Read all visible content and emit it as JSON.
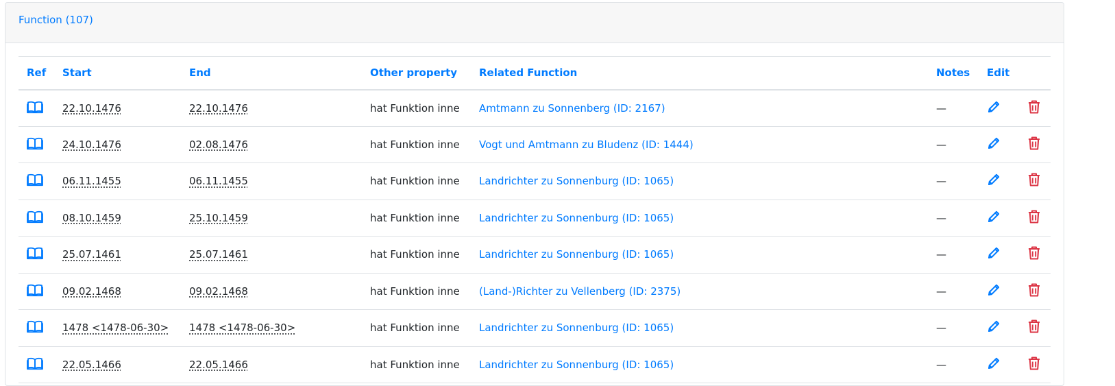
{
  "panel": {
    "title": "Function (107)"
  },
  "table": {
    "headers": {
      "ref": "Ref",
      "start": "Start",
      "end": "End",
      "other_property": "Other property",
      "related_function": "Related Function",
      "notes": "Notes",
      "edit": "Edit"
    },
    "rows": [
      {
        "start": "22.10.1476",
        "end": "22.10.1476",
        "property": "hat Funktion inne",
        "related": "Amtmann zu Sonnenberg (ID: 2167)",
        "notes": "—"
      },
      {
        "start": "24.10.1476",
        "end": "02.08.1476",
        "property": "hat Funktion inne",
        "related": "Vogt und Amtmann zu Bludenz (ID: 1444)",
        "notes": "—"
      },
      {
        "start": "06.11.1455",
        "end": "06.11.1455",
        "property": "hat Funktion inne",
        "related": "Landrichter zu Sonnenburg (ID: 1065)",
        "notes": "—"
      },
      {
        "start": "08.10.1459",
        "end": "25.10.1459",
        "property": "hat Funktion inne",
        "related": "Landrichter zu Sonnenburg (ID: 1065)",
        "notes": "—"
      },
      {
        "start": "25.07.1461",
        "end": "25.07.1461",
        "property": "hat Funktion inne",
        "related": "Landrichter zu Sonnenburg (ID: 1065)",
        "notes": "—"
      },
      {
        "start": "09.02.1468",
        "end": "09.02.1468",
        "property": "hat Funktion inne",
        "related": "(Land-)Richter zu Vellenberg (ID: 2375)",
        "notes": "—"
      },
      {
        "start": "1478 <1478-06-30>",
        "end": "1478 <1478-06-30>",
        "property": "hat Funktion inne",
        "related": "Landrichter zu Sonnenburg (ID: 1065)",
        "notes": "—"
      },
      {
        "start": "22.05.1466",
        "end": "22.05.1466",
        "property": "hat Funktion inne",
        "related": "Landrichter zu Sonnenburg (ID: 1065)",
        "notes": "—"
      }
    ]
  },
  "icons": {
    "ref": "book-icon",
    "edit": "pencil-icon",
    "delete": "trash-icon"
  },
  "colors": {
    "link": "#007bff",
    "delete": "#dc3545",
    "header_bg": "#f7f7f7",
    "border": "#dee2e6",
    "text": "#212529"
  }
}
